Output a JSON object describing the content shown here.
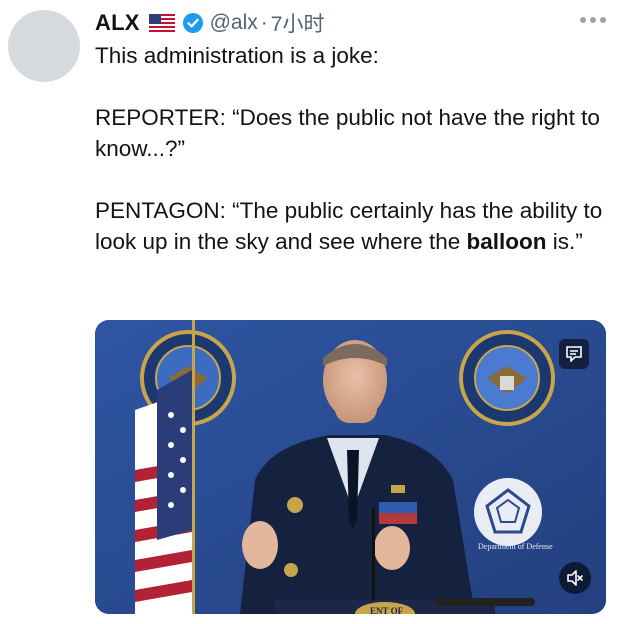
{
  "author": {
    "display_name": "ALX",
    "handle": "@alx",
    "separator": "·",
    "time": "7小时",
    "verified": true,
    "flag": "us-flag-icon"
  },
  "tweet": {
    "line1": "This administration is a joke:",
    "reporter_line": "REPORTER: “Does the public not have the right to know...?”",
    "pentagon_before": "PENTAGON: “The public certainly has the ability to look up in the sky and see where the ",
    "pentagon_bold": "balloon",
    "pentagon_after": " is.”"
  },
  "media": {
    "type": "video",
    "sign_text": "Department of Defense",
    "podium_text": "ENT OF",
    "seal_text": "DEPARTMENT OF DEFENSE"
  },
  "colors": {
    "text": "#0f1419",
    "muted": "#536471",
    "verified": "#1d9bf0",
    "backdrop": "#2b4a8e"
  }
}
